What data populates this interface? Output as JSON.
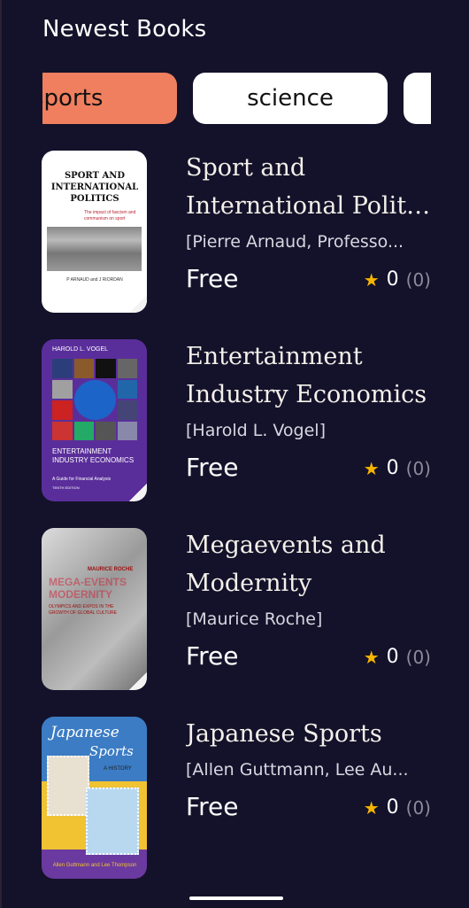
{
  "header": {
    "title": "Newest Books"
  },
  "categories": [
    {
      "label": "sports",
      "active": true
    },
    {
      "label": "science",
      "active": false
    },
    {
      "label": "",
      "active": false
    }
  ],
  "books": [
    {
      "title_line1": "Sport and",
      "title_line2": "International Politi...",
      "author": "[Pierre Arnaud, Professo...",
      "price": "Free",
      "rating": "0",
      "rating_count": "(0)",
      "cover": {
        "title": "SPORT AND INTERNATIONAL POLITICS",
        "subtitle": "The impact of fascism and communism on sport",
        "authors": "P ARNAUD and J RIORDAN"
      }
    },
    {
      "title_line1": "Entertainment",
      "title_line2": "Industry Economics",
      "author": "[Harold L. Vogel]",
      "price": "Free",
      "rating": "0",
      "rating_count": "(0)",
      "cover": {
        "author": "HAROLD L. VOGEL",
        "title": "ENTERTAINMENT INDUSTRY ECONOMICS",
        "subtitle": "A Guide for Financial Analysis",
        "edition": "TENTH EDITION"
      }
    },
    {
      "title_line1": "Megaevents and",
      "title_line2": "Modernity",
      "author": "[Maurice Roche]",
      "price": "Free",
      "rating": "0",
      "rating_count": "(0)",
      "cover": {
        "author": "MAURICE ROCHE",
        "title": "MEGA-EVENTS MODERNITY",
        "subtitle": "OLYMPICS AND EXPOS IN THE GROWTH OF GLOBAL CULTURE"
      }
    },
    {
      "title_line1": "Japanese Sports",
      "title_line2": "",
      "author": "[Allen Guttmann, Lee Au...",
      "price": "Free",
      "rating": "0",
      "rating_count": "(0)",
      "cover": {
        "title1": "Japanese",
        "title2": "Sports",
        "subtitle": "A HISTORY",
        "authors": "Allen Guttmann and Lee Thompson"
      }
    }
  ],
  "colors": {
    "background": "#14122a",
    "chip_active": "#ef7f5f",
    "chip_inactive": "#ffffff",
    "star": "#f7b500"
  },
  "icons": {
    "rating": "star-icon"
  }
}
